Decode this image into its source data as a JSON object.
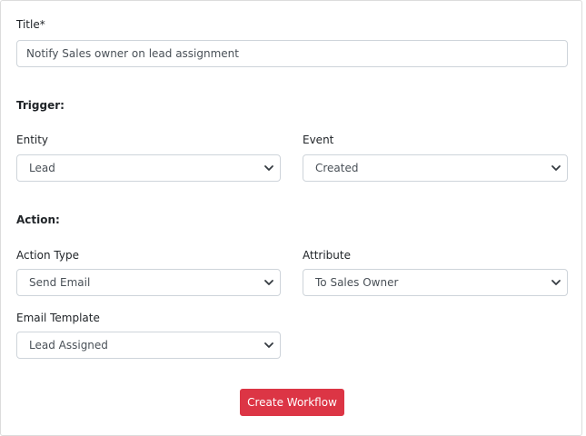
{
  "form": {
    "title_label": "Title*",
    "title_value": "Notify Sales owner on lead assignment",
    "trigger_heading": "Trigger:",
    "entity_label": "Entity",
    "entity_value": "Lead",
    "event_label": "Event",
    "event_value": "Created",
    "action_heading": "Action:",
    "action_type_label": "Action Type",
    "action_type_value": "Send Email",
    "attribute_label": "Attribute",
    "attribute_value": "To Sales Owner",
    "email_template_label": "Email Template",
    "email_template_value": "Lead Assigned",
    "submit_label": "Create Workflow"
  },
  "colors": {
    "primary_button": "#dc3545",
    "border": "#ced4da"
  },
  "icons": {
    "select_chevron": "chevron-down-icon"
  }
}
